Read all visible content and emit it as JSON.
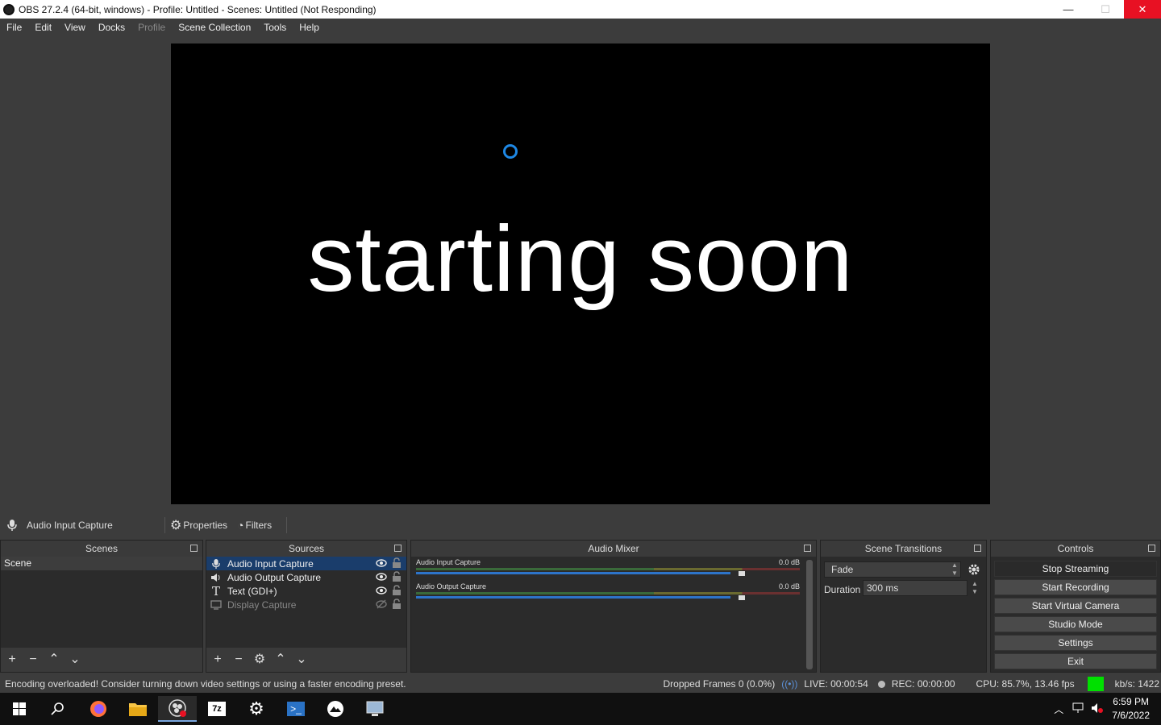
{
  "window": {
    "title": "OBS 27.2.4 (64-bit, windows) - Profile: Untitled - Scenes: Untitled (Not Responding)",
    "minimize": "—",
    "maximize": "☐",
    "close": "✕"
  },
  "menu": [
    "File",
    "Edit",
    "View",
    "Docks",
    "Profile",
    "Scene Collection",
    "Tools",
    "Help"
  ],
  "preview": {
    "text": "starting soon"
  },
  "source_toolbar": {
    "selected_source": "Audio Input Capture",
    "properties_label": "Properties",
    "filters_label": "Filters"
  },
  "scenes": {
    "title": "Scenes",
    "items": [
      "Scene"
    ]
  },
  "sources": {
    "title": "Sources",
    "items": [
      {
        "name": "Audio Input Capture",
        "icon": "microphone-icon",
        "visible": true
      },
      {
        "name": "Audio Output Capture",
        "icon": "speaker-icon",
        "visible": true
      },
      {
        "name": "Text (GDI+)",
        "icon": "text-icon",
        "visible": true
      },
      {
        "name": "Display Capture",
        "icon": "monitor-icon",
        "visible": false
      }
    ]
  },
  "mixer": {
    "title": "Audio Mixer",
    "channels": [
      {
        "name": "Audio Input Capture",
        "db": "0.0 dB"
      },
      {
        "name": "Audio Output Capture",
        "db": "0.0 dB"
      }
    ]
  },
  "transitions": {
    "title": "Scene Transitions",
    "selected": "Fade",
    "duration_label": "Duration",
    "duration_value": "300 ms"
  },
  "controls": {
    "title": "Controls",
    "buttons": [
      "Stop Streaming",
      "Start Recording",
      "Start Virtual Camera",
      "Studio Mode",
      "Settings",
      "Exit"
    ]
  },
  "status": {
    "message": "Encoding overloaded! Consider turning down video settings or using a faster encoding preset.",
    "dropped_frames": "Dropped Frames 0 (0.0%)",
    "live": "LIVE: 00:00:54",
    "rec": "REC: 00:00:00",
    "cpu": "CPU: 85.7%, 13.46 fps",
    "kbps": "kb/s: 1422",
    "health_color": "#00e000"
  },
  "taskbar": {
    "time": "6:59 PM",
    "date": "7/6/2022"
  }
}
